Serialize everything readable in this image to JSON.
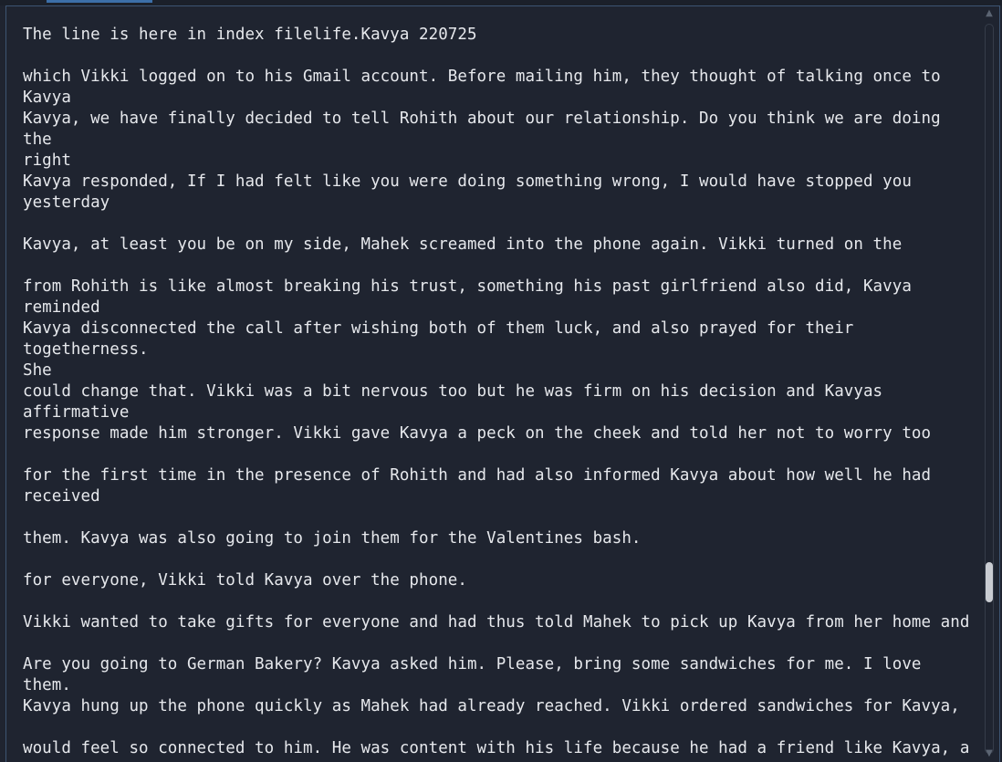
{
  "colors": {
    "background": "#1f2430",
    "text": "#e6e8ec",
    "border": "#3d5572",
    "accent": "#3c6fa8",
    "scroll_thumb": "#c9ccd2"
  },
  "text_view": {
    "lines": [
      "The line is here in index filelife.Kavya 220725",
      "which Vikki logged on to his Gmail account. Before mailing him, they thought of talking once to Kavya",
      "Kavya, we have finally decided to tell Rohith about our relationship. Do you think we are doing the\nright",
      "Kavya responded, If I had felt like you were doing something wrong, I would have stopped you\nyesterday",
      "Kavya, at least you be on my side, Mahek screamed into the phone again. Vikki turned on the",
      "from Rohith is like almost breaking his trust, something his past girlfriend also did, Kavya reminded",
      "Kavya disconnected the call after wishing both of them luck, and also prayed for their togetherness.\nShe",
      "could change that. Vikki was a bit nervous too but he was firm on his decision and Kavyas affirmative",
      "response made him stronger. Vikki gave Kavya a peck on the cheek and told her not to worry too",
      "for the first time in the presence of Rohith and had also informed Kavya about how well he had\nreceived",
      "them. Kavya was also going to join them for the Valentines bash.",
      "for everyone, Vikki told Kavya over the phone.",
      "Vikki wanted to take gifts for everyone and had thus told Mahek to pick up Kavya from her home and",
      "Are you going to German Bakery? Kavya asked him. Please, bring some sandwiches for me. I love them.",
      "Kavya hung up the phone quickly as Mahek had already reached. Vikki ordered sandwiches for Kavya,",
      "would feel so connected to him. He was content with his life because he had a friend like Kavya, a"
    ]
  },
  "scrollbar": {
    "up_glyph": "▲",
    "down_glyph": "▼",
    "position_fraction": 0.78
  }
}
